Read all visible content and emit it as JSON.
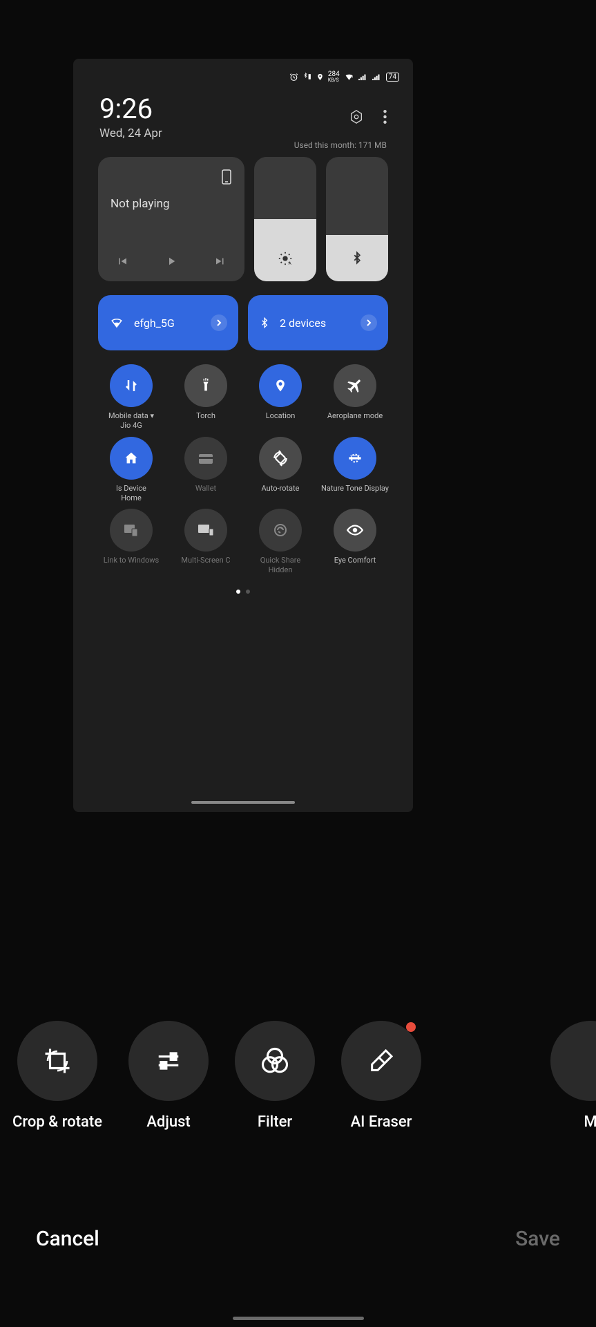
{
  "status_bar": {
    "net_speed": "284",
    "net_unit": "KB/S",
    "battery": "74"
  },
  "header": {
    "time": "9:26",
    "date": "Wed, 24 Apr",
    "usage": "Used this month: 171 MB"
  },
  "media": {
    "status": "Not playing"
  },
  "sliders": {
    "brightness_pct": 50,
    "volume_pct": 37
  },
  "conn": {
    "wifi_label": "efgh_5G",
    "bt_label": "2 devices"
  },
  "tiles": [
    {
      "label": "Mobile data ▾",
      "sub": "Jio 4G",
      "state": "on",
      "icon": "data"
    },
    {
      "label": "Torch",
      "sub": "",
      "state": "off",
      "icon": "torch"
    },
    {
      "label": "Location",
      "sub": "",
      "state": "on",
      "icon": "location"
    },
    {
      "label": "Aeroplane mode",
      "sub": "",
      "state": "off",
      "icon": "airplane"
    },
    {
      "label": "ls    Device",
      "sub": "Home",
      "state": "on",
      "icon": "home"
    },
    {
      "label": "Wallet",
      "sub": "",
      "state": "dim",
      "icon": "wallet"
    },
    {
      "label": "Auto-rotate",
      "sub": "",
      "state": "off",
      "icon": "rotate"
    },
    {
      "label": "Nature Tone Display",
      "sub": "",
      "state": "on",
      "icon": "nature"
    },
    {
      "label": "Link to Windows",
      "sub": "",
      "state": "dim",
      "icon": "link"
    },
    {
      "label": "Multi-Screen C",
      "sub": "",
      "state": "dim",
      "icon": "multi"
    },
    {
      "label": "Quick Share",
      "sub": "Hidden",
      "state": "dim",
      "icon": "share"
    },
    {
      "label": "Eye Comfort",
      "sub": "",
      "state": "off",
      "icon": "eye"
    }
  ],
  "toolbar": [
    {
      "label": "Crop & rotate",
      "icon": "crop"
    },
    {
      "label": "Adjust",
      "icon": "sliders"
    },
    {
      "label": "Filter",
      "icon": "filter"
    },
    {
      "label": "AI Eraser",
      "icon": "eraser",
      "badge": true
    },
    {
      "label": "M",
      "icon": "",
      "partial": true
    }
  ],
  "buttons": {
    "cancel": "Cancel",
    "save": "Save"
  }
}
